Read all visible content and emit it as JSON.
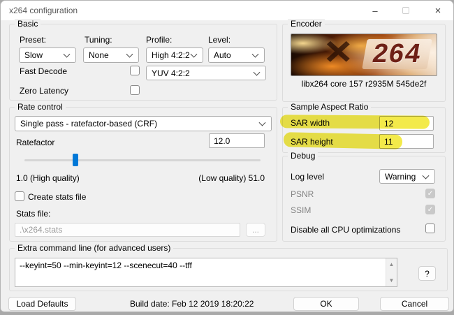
{
  "window": {
    "title": "x264 configuration"
  },
  "icons": {
    "check": "✓",
    "close": "×",
    "minimize": "–",
    "scroll_up": "▲",
    "scroll_down": "▼"
  },
  "basic": {
    "label": "Basic",
    "preset_label": "Preset:",
    "preset_value": "Slow",
    "tuning_label": "Tuning:",
    "tuning_value": "None",
    "profile_label": "Profile:",
    "profile_value": "High 4:2:2",
    "level_label": "Level:",
    "level_value": "Auto",
    "fast_decode_label": "Fast Decode",
    "colorspace_value": "YUV 4:2:2",
    "zero_latency_label": "Zero Latency"
  },
  "encoder": {
    "label": "Encoder",
    "logo_x": "×",
    "logo_number": "264",
    "version": "libx264 core 157 r2935M 545de2f"
  },
  "rate_control": {
    "label": "Rate control",
    "mode_value": "Single pass - ratefactor-based (CRF)",
    "ratefactor_label": "Ratefactor",
    "ratefactor_value": "12.0",
    "scale_min": "1.0 (High quality)",
    "scale_max": "(Low quality) 51.0",
    "create_stats_label": "Create stats file",
    "stats_file_label": "Stats file:",
    "stats_file_value": ".\\x264.stats",
    "browse_label": "..."
  },
  "sar": {
    "label": "Sample Aspect Ratio",
    "width_label": "SAR width",
    "width_value": "12",
    "height_label": "SAR height",
    "height_value": "11",
    "highlight_color": "#f2e93a"
  },
  "debug": {
    "label": "Debug",
    "log_level_label": "Log level",
    "log_level_value": "Warning",
    "psnr_label": "PSNR",
    "ssim_label": "SSIM",
    "cpu_label": "Disable all CPU optimizations"
  },
  "extra": {
    "label": "Extra command line (for advanced users)",
    "command_value": "--keyint=50 --min-keyint=12 --scenecut=40 --tff",
    "help_label": "?"
  },
  "footer": {
    "load_defaults_label": "Load Defaults",
    "build_date": "Build date: Feb 12 2019 18:20:22",
    "ok_label": "OK",
    "cancel_label": "Cancel"
  },
  "colors": {
    "accent": "#0078d7",
    "highlight": "#f2e93a"
  }
}
